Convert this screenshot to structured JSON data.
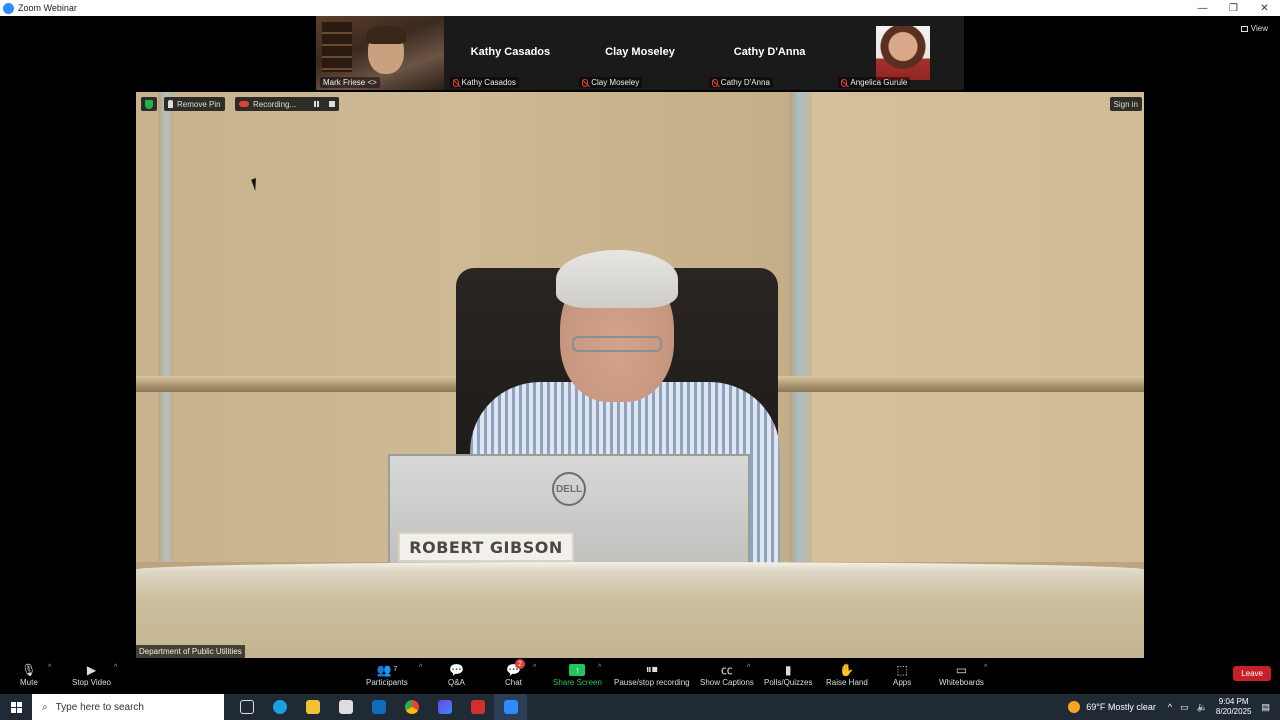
{
  "window": {
    "title": "Zoom Webinar",
    "controls": [
      "—",
      "❐",
      "✕"
    ]
  },
  "view_button": "View",
  "participants_strip": [
    {
      "name": "Mark Friese <>",
      "type": "video"
    },
    {
      "name": "Kathy Casados",
      "display": "Kathy Casados",
      "type": "name"
    },
    {
      "name": "Clay Moseley",
      "display": "Clay Moseley",
      "type": "name"
    },
    {
      "name": "Cathy D'Anna",
      "display": "Cathy D'Anna",
      "type": "name"
    },
    {
      "name": "Angelica Gurule",
      "type": "photo"
    }
  ],
  "overlay": {
    "remove_pin": "Remove Pin",
    "recording": "Recording...",
    "sign_in": "Sign in"
  },
  "main_video": {
    "nameplate": "ROBERT GIBSON",
    "monitor_brand": "DELL",
    "source_label": "Department of Public Utilities"
  },
  "toolbar": {
    "mute": "Mute",
    "stop_video": "Stop Video",
    "participants": "Participants",
    "participants_count": "7",
    "qa": "Q&A",
    "chat": "Chat",
    "chat_badge": "2",
    "share_screen": "Share Screen",
    "pause_stop_recording": "Pause/stop recording",
    "show_captions": "Show Captions",
    "polls": "Polls/Quizzes",
    "raise_hand": "Raise Hand",
    "apps": "Apps",
    "whiteboards": "Whiteboards",
    "leave": "Leave"
  },
  "taskbar": {
    "search_placeholder": "Type here to search",
    "weather": "69°F  Mostly clear",
    "time": "9:04 PM",
    "date": "8/20/2025"
  },
  "colors": {
    "accent_green": "#22c55e",
    "leave_red": "#c8202a",
    "zoom_blue": "#2d8cff"
  }
}
